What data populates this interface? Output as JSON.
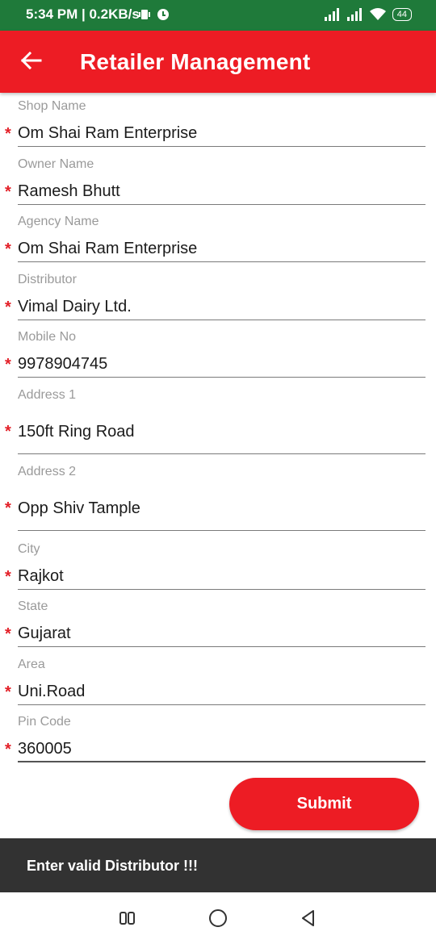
{
  "status_bar": {
    "time": "5:34 PM | 0.2KB/s",
    "battery": "44"
  },
  "app_bar": {
    "title": "Retailer Management"
  },
  "form": {
    "required_marker": "*",
    "fields": [
      {
        "label": "Shop Name",
        "value": "Om Shai Ram Enterprise"
      },
      {
        "label": "Owner Name",
        "value": "Ramesh Bhutt"
      },
      {
        "label": "Agency Name",
        "value": "Om Shai Ram Enterprise"
      },
      {
        "label": "Distributor",
        "value": "Vimal Dairy Ltd."
      },
      {
        "label": "Mobile No",
        "value": "9978904745"
      },
      {
        "label": "Address 1",
        "value": "150ft Ring Road"
      },
      {
        "label": "Address 2",
        "value": "Opp Shiv Tample"
      },
      {
        "label": "City",
        "value": "Rajkot"
      },
      {
        "label": "State",
        "value": "Gujarat"
      },
      {
        "label": "Area",
        "value": "Uni.Road"
      },
      {
        "label": "Pin Code",
        "value": "360005"
      }
    ],
    "submit_label": "Submit"
  },
  "snackbar": {
    "message": "Enter valid Distributor !!!"
  },
  "colors": {
    "app_bar": "#ed1c24",
    "status_bar": "#1f7a3a",
    "required": "#e32028",
    "snackbar": "#323232"
  }
}
